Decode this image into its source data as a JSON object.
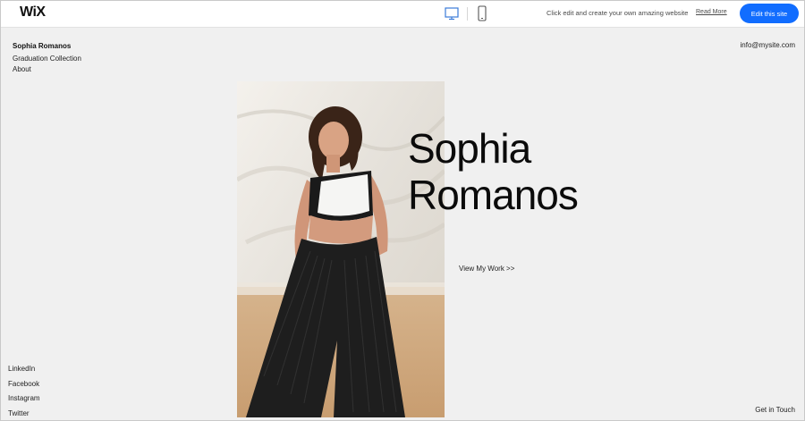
{
  "topbar": {
    "logo": "WiX",
    "promo_text": "Click edit and create your own amazing website",
    "read_more": "Read More",
    "edit_button": "Edit this site"
  },
  "site": {
    "name": "Sophia Romanos",
    "nav": [
      "Graduation Collection",
      "About"
    ],
    "email": "info@mysite.com",
    "hero_title": "Sophia\nRomanos",
    "cta": "View My Work >>",
    "social": [
      "LinkedIn",
      "Facebook",
      "Instagram",
      "Twitter"
    ],
    "contact": "Get in Touch"
  },
  "colors": {
    "accent": "#116dff",
    "background": "#f0f0f0"
  },
  "icons": [
    "desktop-icon",
    "mobile-icon"
  ]
}
